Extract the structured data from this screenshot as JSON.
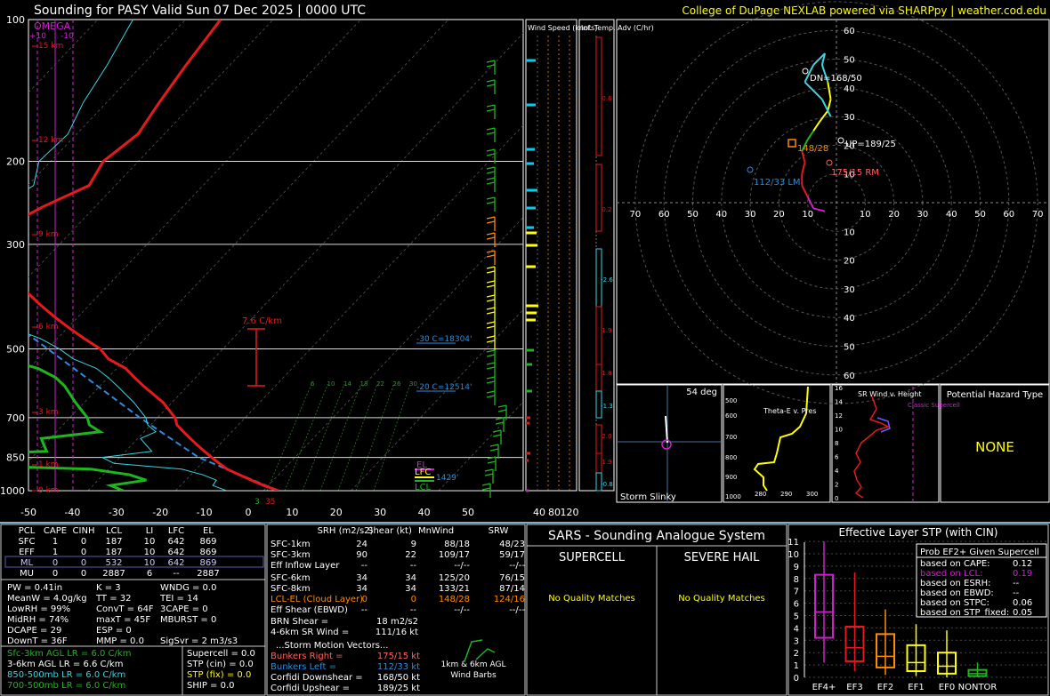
{
  "header": {
    "title": "Sounding for PASY Valid  Sun 07 Dec 2025 | 0000 UTC",
    "credit": "College of DuPage NEXLAB powered via SHARPpy | weather.cod.edu"
  },
  "colors": {
    "temp": "#e41a1c",
    "dewp": "#1fb51f",
    "wetbulb": "#3ad4e0",
    "parcel": "#2b8be0",
    "omega": "#cc22cc",
    "yellow": "#ffff00",
    "cyan": "#00d0f0",
    "orange": "#ff8c00"
  },
  "skewt": {
    "omega_label": "OMEGA",
    "omega_ticks": [
      "+10",
      "-10"
    ],
    "height_labels": [
      "15 km",
      "12 km",
      "9 km",
      "6 km",
      "3 km",
      "1 km",
      "0 km"
    ],
    "pressure_labels": [
      "100",
      "200",
      "300",
      "500",
      "700",
      "850",
      "1000"
    ],
    "temp_ticks": [
      "-50",
      "-40",
      "-30",
      "-20",
      "-10",
      "0",
      "10",
      "20",
      "30",
      "40",
      "50"
    ],
    "lapse_label": "7.6 C/km",
    "levels": [
      "-30 C=18304'",
      "-20 C=12514'"
    ],
    "mix_labels": [
      "6",
      "10",
      "14",
      "18",
      "22",
      "26",
      "30"
    ],
    "parcel_labels": [
      "EL",
      "LFC",
      "LCL"
    ],
    "sfc_label": "1429'",
    "sfc_t": "35",
    "sfc_td": "3"
  },
  "windspeed": {
    "title": "Wind Speed (knots)",
    "ticks": [
      "40",
      "80",
      "120"
    ]
  },
  "inftemp": {
    "title": "Inf. Temp. Adv (C/hr)",
    "labels": [
      "0.6",
      "0.2",
      "-2.6",
      "1.9",
      "1.8",
      "-1.3",
      "2.0",
      "1.9",
      "-0.8"
    ]
  },
  "hodograph": {
    "ring_labels_vertical": [
      "60",
      "50",
      "40",
      "30",
      "20",
      "10",
      "10",
      "20",
      "30",
      "40",
      "50",
      "60"
    ],
    "ring_labels_horizontal": [
      "70",
      "60",
      "50",
      "40",
      "30",
      "20",
      "10",
      "10",
      "20",
      "30",
      "40",
      "50",
      "60",
      "70"
    ],
    "markers": [
      "DN=168/50",
      "UP=189/25",
      "148/28",
      "175/15 RM",
      "112/33 LM"
    ]
  },
  "slinky": {
    "deg": "54 deg",
    "label": "Storm Slinky"
  },
  "theta": {
    "title": "Theta-E v. Pres",
    "ylabels": [
      "500",
      "600",
      "700",
      "800",
      "900",
      "1000"
    ],
    "xlabels": [
      "280",
      "290",
      "300"
    ]
  },
  "srwind": {
    "title": "SR Wind v. Height",
    "classic": "Classic Supercell",
    "ylabels": [
      "16",
      "14",
      "12",
      "10",
      "8",
      "6",
      "4",
      "2",
      "0"
    ]
  },
  "hazard": {
    "title": "Potential Hazard Type",
    "value": "NONE"
  },
  "parcels": {
    "headers": [
      "PCL",
      "CAPE",
      "CINH",
      "LCL",
      "LI",
      "LFC",
      "EL"
    ],
    "rows": [
      [
        "SFC",
        "1",
        "0",
        "187",
        "10",
        "642",
        "869"
      ],
      [
        "EFF",
        "1",
        "0",
        "187",
        "10",
        "642",
        "869"
      ],
      [
        "ML",
        "0",
        "0",
        "532",
        "10",
        "642",
        "869"
      ],
      [
        "MU",
        "0",
        "0",
        "2887",
        "6",
        "--",
        "2887"
      ]
    ]
  },
  "indices": {
    "c1": [
      "PW = 0.41in",
      "MeanW = 4.0g/kg",
      "LowRH = 99%",
      "MidRH = 74%",
      "DCAPE = 29",
      "DownT = 36F"
    ],
    "c2": [
      "K = 3",
      "TT = 32",
      "ConvT = 64F",
      "maxT = 45F",
      "ESP = 0",
      "MMP = 0.0"
    ],
    "c3": [
      "WNDG = 0.0",
      "TEI = 14",
      "3CAPE = 0",
      "MBURST = 0",
      "",
      "SigSvr = 2 m3/s3"
    ]
  },
  "lapse": [
    "Sfc-3km AGL LR = 6.0 C/km",
    "3-6km AGL LR = 6.6 C/km",
    "850-500mb LR = 6.0 C/km",
    "700-500mb LR = 6.0 C/km"
  ],
  "composite": [
    "Supercell = 0.0",
    "STP (cin) = 0.0",
    "STP (fix) = 0.0",
    "SHIP = 0.0"
  ],
  "kin": {
    "headers": [
      "SRH (m2/s2)",
      "Shear (kt)",
      "MnWind",
      "SRW"
    ],
    "rows": [
      [
        "SFC-1km",
        "24",
        "9",
        "88/18",
        "48/23"
      ],
      [
        "SFC-3km",
        "90",
        "22",
        "109/17",
        "59/17"
      ],
      [
        "Eff Inflow Layer",
        "--",
        "--",
        "--/--",
        "--/--"
      ],
      [
        "SFC-6km",
        "34",
        "34",
        "125/20",
        "76/15"
      ],
      [
        "SFC-8km",
        "34",
        "34",
        "133/21",
        "87/14"
      ],
      [
        "LCL-EL (Cloud Layer)",
        "0",
        "0",
        "148/28",
        "124/16"
      ],
      [
        "Eff Shear (EBWD)",
        "--",
        "--",
        "--/--",
        "--/--"
      ]
    ],
    "brn": [
      "BRN Shear =",
      "18 m2/s2"
    ],
    "srw46": [
      "4-6km SR Wind =",
      "111/16 kt"
    ],
    "storm_title": "...Storm Motion Vectors...",
    "motions": [
      [
        "Bunkers Right =",
        "175/15 kt"
      ],
      [
        "Bunkers Left =",
        "112/33 kt"
      ],
      [
        "Corfidi Downshear =",
        "168/50 kt"
      ],
      [
        "Corfidi Upshear =",
        "189/25 kt"
      ]
    ],
    "barb_label": "1km & 6km AGL Wind Barbs"
  },
  "sars": {
    "title": "SARS - Sounding Analogue System",
    "left": "SUPERCELL",
    "right": "SEVERE HAIL",
    "nomatch": "No Quality Matches"
  },
  "stp": {
    "title": "Effective Layer STP (with CIN)",
    "box_title": "Prob EF2+ Given Supercell",
    "probs": [
      [
        "based on CAPE:",
        "0.12"
      ],
      [
        "based on LCL:",
        "0.19"
      ],
      [
        "based on ESRH:",
        "--"
      ],
      [
        "based on EBWD:",
        "--"
      ],
      [
        "based on STPC:",
        "0.06"
      ],
      [
        "based on STP_fixed:",
        "0.05"
      ]
    ],
    "yticks": [
      "0",
      "1",
      "2",
      "3",
      "4",
      "5",
      "6",
      "7",
      "8",
      "9",
      "10",
      "11"
    ]
  },
  "chart_data": {
    "type": "line",
    "xlabel": "",
    "ylabel": "",
    "xlim": [
      -50,
      50
    ],
    "ylim": [
      1000,
      100
    ],
    "pressure": [
      1000,
      975,
      950,
      925,
      900,
      875,
      850,
      825,
      800,
      775,
      750,
      725,
      700,
      650,
      600,
      575,
      550,
      525,
      500,
      475,
      450,
      425,
      400,
      375,
      350,
      325,
      300,
      275,
      250,
      225,
      200,
      175,
      150,
      125,
      100
    ],
    "temperature": [
      1.7,
      -0.5,
      -2.5,
      -4.5,
      -6.5,
      -8,
      -9.5,
      -11,
      -12.5,
      -14,
      -15.5,
      -17,
      -18,
      -21,
      -25,
      -27,
      -29,
      -32,
      -34,
      -37,
      -40,
      -43,
      -46,
      -49,
      -52,
      -56,
      -58,
      -58,
      -56,
      -53,
      -54,
      -53,
      -54,
      -55,
      -56
    ],
    "dewpoint": [
      -16,
      -18,
      -14.5,
      -17,
      -22,
      -44,
      -47,
      -29,
      -30,
      -31,
      -25,
      -27,
      -28,
      -31,
      -34,
      -36,
      -39,
      -44,
      -48,
      -52,
      -60,
      -60,
      -62,
      -62,
      -67,
      -67,
      -67,
      -67,
      -71,
      -72,
      -76,
      -77,
      -80,
      -82,
      -86
    ],
    "series": [
      {
        "name": "",
        "values": []
      }
    ],
    "hodograph_u": [
      -4,
      -8,
      -10,
      -12,
      -12,
      -11,
      -12,
      -10,
      -8,
      -6,
      -3,
      -2,
      -3,
      -5,
      -4,
      -8,
      -10,
      -11,
      -5,
      -2
    ],
    "hodograph_v": [
      -3,
      -2,
      2,
      6,
      10,
      14,
      18,
      22,
      25,
      28,
      32,
      36,
      42,
      48,
      52,
      48,
      44,
      42,
      36,
      30
    ],
    "stp_classes": [
      "EF4+",
      "EF3",
      "EF2",
      "EF1",
      "EF0",
      "NONTOR"
    ],
    "stp_box": [
      {
        "lo": 1.2,
        "q1": 3.2,
        "med": 5.3,
        "q3": 8.3,
        "hi": 11
      },
      {
        "lo": 0.5,
        "q1": 1.3,
        "med": 2.4,
        "q3": 4.1,
        "hi": 8.5
      },
      {
        "lo": 0.2,
        "q1": 0.8,
        "med": 1.7,
        "q3": 3.5,
        "hi": 5.5
      },
      {
        "lo": 0.1,
        "q1": 0.5,
        "med": 1.2,
        "q3": 2.6,
        "hi": 4.3
      },
      {
        "lo": 0.0,
        "q1": 0.3,
        "med": 0.9,
        "q3": 2.0,
        "hi": 3.8
      },
      {
        "lo": 0.0,
        "q1": 0.1,
        "med": 0.3,
        "q3": 0.6,
        "hi": 1.2
      }
    ]
  }
}
